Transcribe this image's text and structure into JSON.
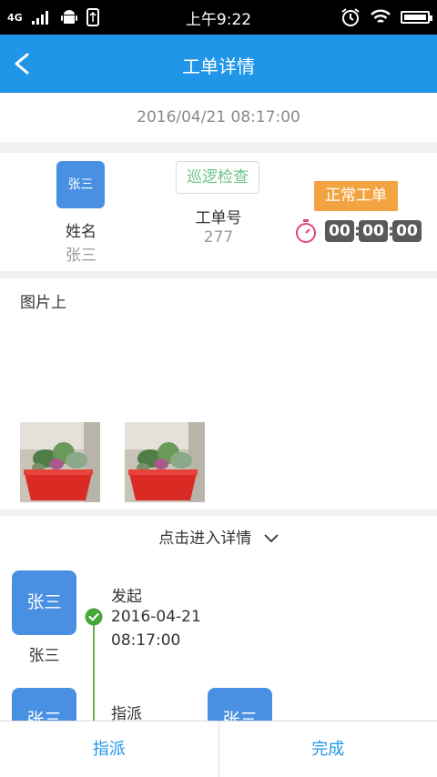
{
  "status_bar": {
    "time": "上午9:22",
    "network": "4G"
  },
  "header": {
    "title": "工单详情"
  },
  "date_bar": {
    "datetime": "2016/04/21 08:17:00"
  },
  "info": {
    "avatar_text": "张三",
    "name_label": "姓名",
    "name_value": "张三",
    "tag_type": "巡逻检查",
    "order_label": "工单号",
    "order_value": "277",
    "tag_status": "正常工单",
    "timer": {
      "hours": "00",
      "minutes": "00",
      "seconds": "00"
    }
  },
  "photos": {
    "label": "图片上"
  },
  "detail": {
    "link_label": "点击进入详情"
  },
  "timeline": {
    "step1": {
      "avatar_text": "张三",
      "name": "张三",
      "title": "发起",
      "date": "2016-04-21",
      "time": "08:17:00"
    },
    "step2": {
      "avatar_text": "张三",
      "title": "指派",
      "assignee_avatar_text": "张三"
    }
  },
  "bottom_bar": {
    "assign_label": "指派",
    "complete_label": "完成"
  },
  "colors": {
    "primary": "#2196e8",
    "avatar": "#4a90e2",
    "tag_green": "#6dc387",
    "tag_orange": "#f3a442",
    "timeline_green": "#6ab04c"
  }
}
